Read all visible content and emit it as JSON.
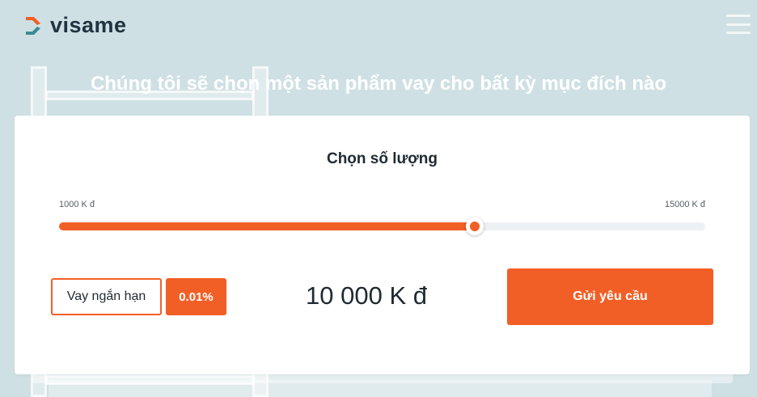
{
  "brand": {
    "name": "visame",
    "accent": "#f25f26",
    "dark": "#1f3340",
    "teal": "#3a8a93"
  },
  "header": {
    "menu_icon": "hamburger-menu-icon"
  },
  "hero": {
    "title": "Chúng tôi sẽ chọn một sản phẩm vay cho bất kỳ mục đích nào"
  },
  "calculator": {
    "title": "Chọn số lượng",
    "range_min_label": "1000 K đ",
    "range_max_label": "15000 K đ",
    "slider": {
      "min": 1000,
      "max": 15000,
      "value": 10000
    },
    "loan_type_label": "Vay ngắn hạn",
    "rate_label": "0.01%",
    "amount_label": "10 000 K đ",
    "submit_label": "Gửi yêu cầu"
  }
}
